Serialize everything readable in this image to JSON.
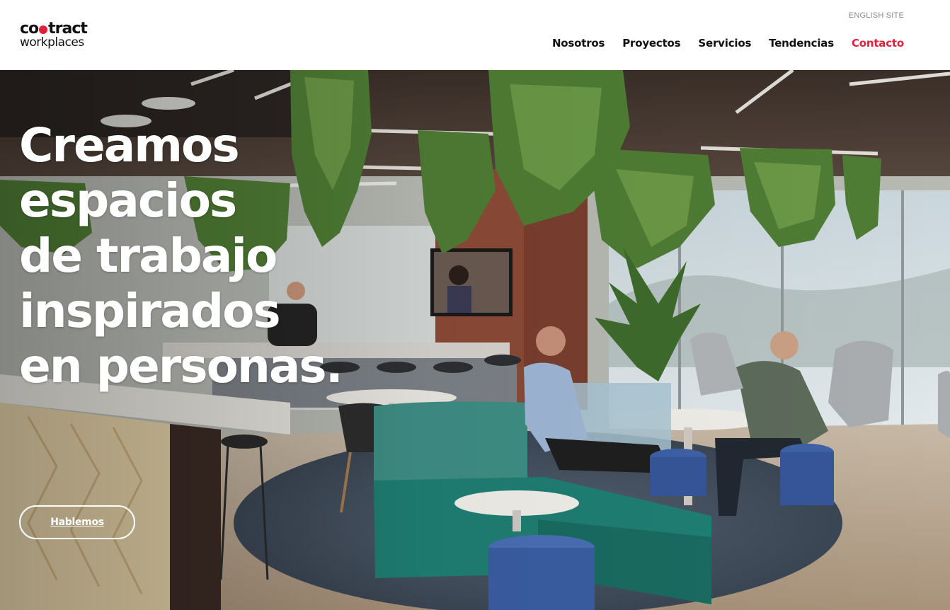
{
  "header": {
    "logo": {
      "line1_a": "co",
      "line1_b": "tract",
      "line2": "workplaces"
    },
    "lang_link": "ENGLISH SITE",
    "nav": [
      {
        "label": "Nosotros",
        "active": false
      },
      {
        "label": "Proyectos",
        "active": false
      },
      {
        "label": "Servicios",
        "active": false
      },
      {
        "label": "Tendencias",
        "active": false
      },
      {
        "label": "Contacto",
        "active": true
      }
    ]
  },
  "hero": {
    "title_lines": [
      "Creamos",
      "espacios",
      "de trabajo",
      "inspirados",
      "en personas."
    ],
    "cta_label": "Hablemos"
  },
  "colors": {
    "accent": "#e1203c",
    "text_dark": "#111111",
    "muted": "#8a8a8a",
    "sofa": "#1f7f73",
    "ottoman": "#3f61a6"
  }
}
